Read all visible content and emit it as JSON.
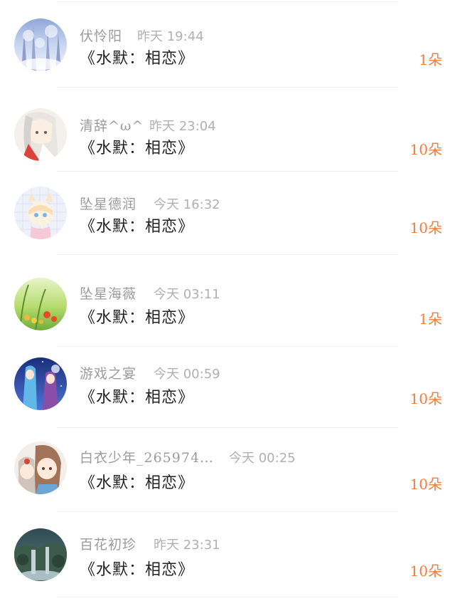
{
  "colors": {
    "name": "#9b9b9b",
    "time": "#b0b0b0",
    "title": "#222222",
    "count": "#f07d3a",
    "divider": "#eeeeee"
  },
  "gifts": [
    {
      "user": "伏怜阳",
      "time": "昨天 19:44",
      "item": "《水默：相恋》",
      "count": "1朵",
      "avatar": "winter-forest-avatar"
    },
    {
      "user": "清辞^ω^",
      "time": "昨天 23:04",
      "item": "《水默：相恋》",
      "count": "10朵",
      "avatar": "anime-white-hair-avatar"
    },
    {
      "user": "坠星德润",
      "time": "今天 16:32",
      "item": "《水默：相恋》",
      "count": "10朵",
      "avatar": "anime-fox-girl-avatar"
    },
    {
      "user": "坠星海薇",
      "time": "今天 03:11",
      "item": "《水默：相恋》",
      "count": "1朵",
      "avatar": "spring-flowers-avatar"
    },
    {
      "user": "游戏之宴",
      "time": "今天 00:59",
      "item": "《水默：相恋》",
      "count": "10朵",
      "avatar": "anime-couple-night-avatar"
    },
    {
      "user": "白衣少年_265974…",
      "time": "今天 00:25",
      "item": "《水默：相恋》",
      "count": "10朵",
      "avatar": "chibi-children-avatar"
    },
    {
      "user": "百花初珍",
      "time": "昨天 23:31",
      "item": "《水默：相恋》",
      "count": "10朵",
      "avatar": "waterfall-landscape-avatar"
    }
  ]
}
